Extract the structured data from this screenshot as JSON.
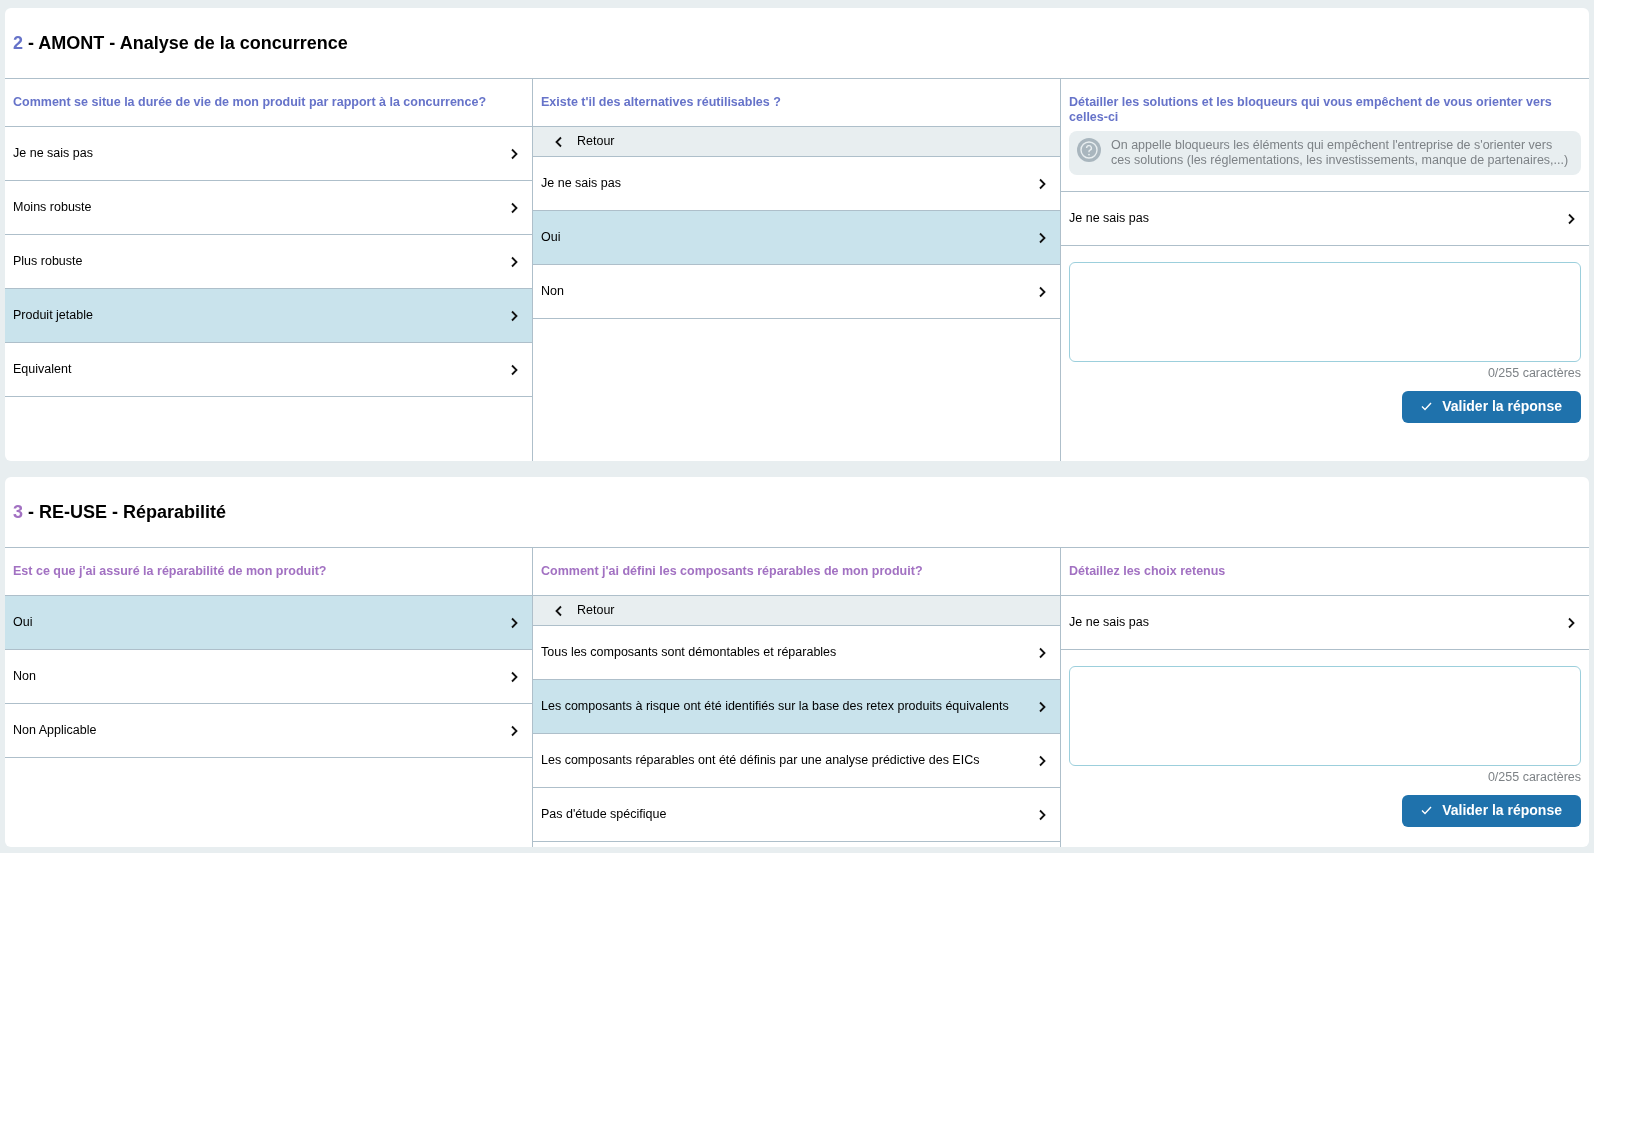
{
  "sections": [
    {
      "number": "2",
      "title": "- AMONT - Analyse de la concurrence",
      "color": "#6673c9",
      "columns": [
        {
          "kind": "choices",
          "question": "Comment se situe la durée de vie de mon produit par rapport à la concurrence?",
          "options": [
            {
              "label": "Je ne sais pas",
              "selected": false
            },
            {
              "label": "Moins robuste",
              "selected": false
            },
            {
              "label": "Plus robuste",
              "selected": false
            },
            {
              "label": "Produit jetable",
              "selected": true
            },
            {
              "label": "Equivalent",
              "selected": false
            }
          ]
        },
        {
          "kind": "choices",
          "question": "Existe t'il des alternatives réutilisables ?",
          "back": "Retour",
          "options": [
            {
              "label": "Je ne sais pas",
              "selected": false
            },
            {
              "label": "Oui",
              "selected": true
            },
            {
              "label": "Non",
              "selected": false
            }
          ]
        },
        {
          "kind": "comment",
          "question": "Détailler les solutions et les bloqueurs qui vous empêchent de vous orienter vers celles-ci",
          "hint": "On appelle bloqueurs les éléments qui empêchent l'entreprise de s'orienter vers ces solutions (les réglementations, les investissements, manque de partenaires,...)",
          "options": [
            {
              "label": "Je ne sais pas",
              "selected": false
            }
          ],
          "counter": "0/255 caractères",
          "button": "Valider la réponse"
        }
      ]
    },
    {
      "number": "3",
      "title": "- RE-USE - Réparabilité",
      "color": "#a271c2",
      "columns": [
        {
          "kind": "choices",
          "question": "Est ce que j'ai assuré la réparabilité de mon produit?",
          "options": [
            {
              "label": "Oui",
              "selected": true
            },
            {
              "label": "Non",
              "selected": false
            },
            {
              "label": "Non Applicable",
              "selected": false
            }
          ]
        },
        {
          "kind": "choices",
          "question": "Comment j'ai défini les composants réparables de mon produit?",
          "back": "Retour",
          "options": [
            {
              "label": "Tous les composants sont démontables et réparables",
              "selected": false
            },
            {
              "label": "Les composants à risque ont été identifiés sur la base des retex produits équivalents",
              "selected": true
            },
            {
              "label": "Les composants réparables ont été définis par une analyse prédictive des EICs",
              "selected": false
            },
            {
              "label": "Pas d'étude spécifique",
              "selected": false
            }
          ]
        },
        {
          "kind": "comment",
          "question": "Détaillez les choix retenus",
          "options": [
            {
              "label": "Je ne sais pas",
              "selected": false
            }
          ],
          "counter": "0/255 caractères",
          "button": "Valider la réponse"
        }
      ]
    }
  ]
}
